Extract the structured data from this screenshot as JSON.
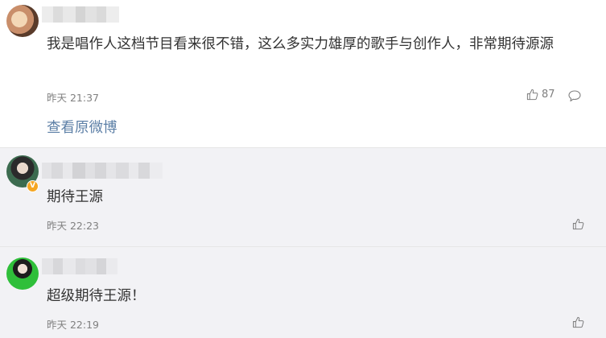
{
  "comments": [
    {
      "avatar_icon": "avatar-icon",
      "text": "我是唱作人这档节目看来很不错，这么多实力雄厚的歌手与创作人，非常期待源源",
      "time": "昨天 21:37",
      "likes": "87",
      "link": "查看原微博"
    },
    {
      "avatar_icon": "avatar-icon",
      "text": "期待王源",
      "time": "昨天 22:23",
      "verified_badge": "V"
    },
    {
      "avatar_icon": "avatar-icon",
      "text": "超级期待王源！",
      "time": "昨天 22:19"
    }
  ],
  "colors": {
    "link": "#5c7fa6",
    "meta": "#808080",
    "reply_bg": "#f2f2f5",
    "verified": "#f5a623"
  }
}
